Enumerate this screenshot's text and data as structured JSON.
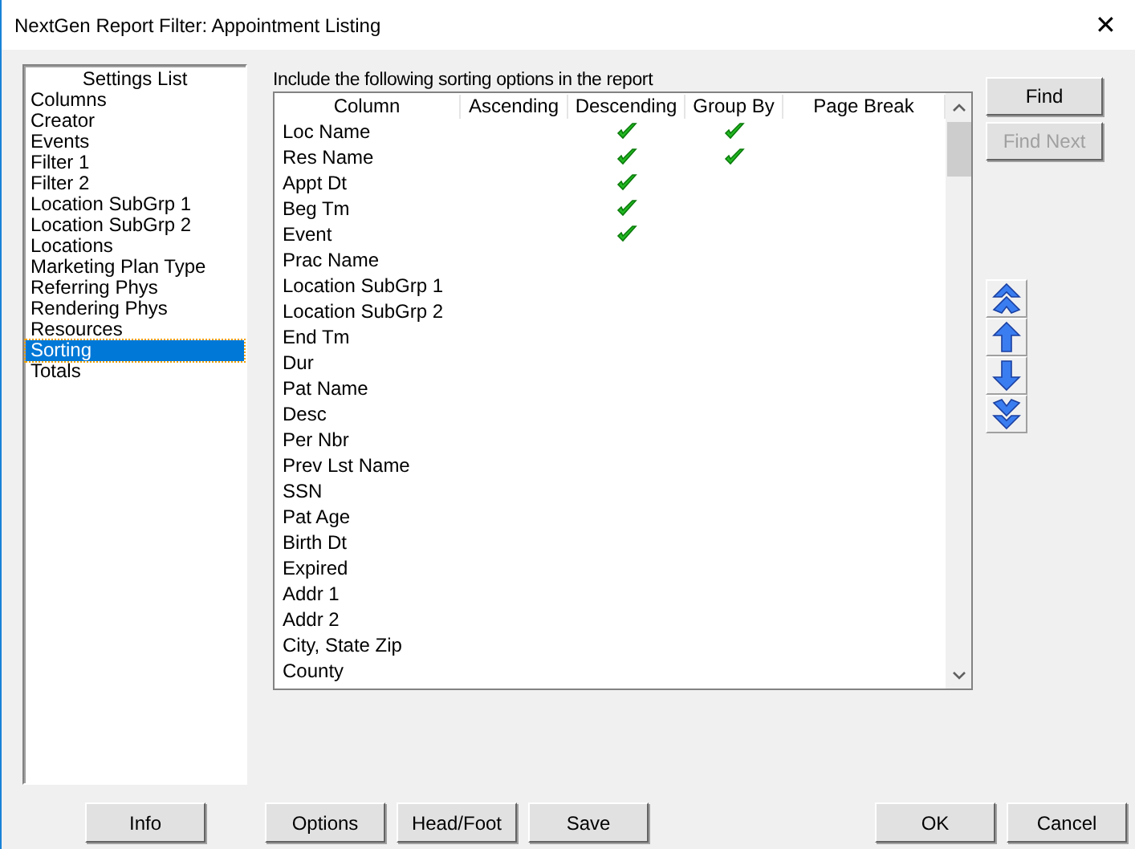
{
  "window": {
    "title": "NextGen Report Filter: Appointment Listing",
    "close_glyph": "✕"
  },
  "settings_list": {
    "title": "Settings List",
    "items": [
      {
        "label": "Columns",
        "selected": false
      },
      {
        "label": "Creator",
        "selected": false
      },
      {
        "label": "Events",
        "selected": false
      },
      {
        "label": "Filter 1",
        "selected": false
      },
      {
        "label": "Filter 2",
        "selected": false
      },
      {
        "label": "Location SubGrp 1",
        "selected": false
      },
      {
        "label": "Location SubGrp 2",
        "selected": false
      },
      {
        "label": "Locations",
        "selected": false
      },
      {
        "label": "Marketing Plan Type",
        "selected": false
      },
      {
        "label": "Referring Phys",
        "selected": false
      },
      {
        "label": "Rendering Phys",
        "selected": false
      },
      {
        "label": "Resources",
        "selected": false
      },
      {
        "label": "Sorting",
        "selected": true
      },
      {
        "label": "Totals",
        "selected": false
      }
    ]
  },
  "sorting": {
    "caption": "Include the following sorting options in the report",
    "columns": [
      "Column",
      "Ascending",
      "Descending",
      "Group By",
      "Page Break"
    ],
    "rows": [
      {
        "name": "Loc Name",
        "ascending": false,
        "descending": true,
        "group_by": true,
        "page_break": false
      },
      {
        "name": "Res Name",
        "ascending": false,
        "descending": true,
        "group_by": true,
        "page_break": false
      },
      {
        "name": "Appt Dt",
        "ascending": false,
        "descending": true,
        "group_by": false,
        "page_break": false
      },
      {
        "name": "Beg Tm",
        "ascending": false,
        "descending": true,
        "group_by": false,
        "page_break": false
      },
      {
        "name": "Event",
        "ascending": false,
        "descending": true,
        "group_by": false,
        "page_break": false
      },
      {
        "name": "Prac Name",
        "ascending": false,
        "descending": false,
        "group_by": false,
        "page_break": false
      },
      {
        "name": "Location SubGrp 1",
        "ascending": false,
        "descending": false,
        "group_by": false,
        "page_break": false
      },
      {
        "name": "Location SubGrp 2",
        "ascending": false,
        "descending": false,
        "group_by": false,
        "page_break": false
      },
      {
        "name": "End Tm",
        "ascending": false,
        "descending": false,
        "group_by": false,
        "page_break": false
      },
      {
        "name": "Dur",
        "ascending": false,
        "descending": false,
        "group_by": false,
        "page_break": false
      },
      {
        "name": "Pat Name",
        "ascending": false,
        "descending": false,
        "group_by": false,
        "page_break": false
      },
      {
        "name": "Desc",
        "ascending": false,
        "descending": false,
        "group_by": false,
        "page_break": false
      },
      {
        "name": "Per Nbr",
        "ascending": false,
        "descending": false,
        "group_by": false,
        "page_break": false
      },
      {
        "name": "Prev Lst Name",
        "ascending": false,
        "descending": false,
        "group_by": false,
        "page_break": false
      },
      {
        "name": "SSN",
        "ascending": false,
        "descending": false,
        "group_by": false,
        "page_break": false
      },
      {
        "name": "Pat Age",
        "ascending": false,
        "descending": false,
        "group_by": false,
        "page_break": false
      },
      {
        "name": "Birth Dt",
        "ascending": false,
        "descending": false,
        "group_by": false,
        "page_break": false
      },
      {
        "name": "Expired",
        "ascending": false,
        "descending": false,
        "group_by": false,
        "page_break": false
      },
      {
        "name": "Addr 1",
        "ascending": false,
        "descending": false,
        "group_by": false,
        "page_break": false
      },
      {
        "name": "Addr 2",
        "ascending": false,
        "descending": false,
        "group_by": false,
        "page_break": false
      },
      {
        "name": "City, State Zip",
        "ascending": false,
        "descending": false,
        "group_by": false,
        "page_break": false
      },
      {
        "name": "County",
        "ascending": false,
        "descending": false,
        "group_by": false,
        "page_break": false
      }
    ]
  },
  "side_buttons": [
    {
      "label": "Find",
      "disabled": false
    },
    {
      "label": "Find Next",
      "disabled": true
    }
  ],
  "move_buttons": [
    {
      "kind": "top"
    },
    {
      "kind": "up"
    },
    {
      "kind": "down"
    },
    {
      "kind": "bottom"
    }
  ],
  "bottom_buttons": {
    "left": [
      "Info"
    ],
    "middle": [
      "Options",
      "Head/Foot",
      "Save"
    ],
    "right": [
      "OK",
      "Cancel"
    ]
  }
}
